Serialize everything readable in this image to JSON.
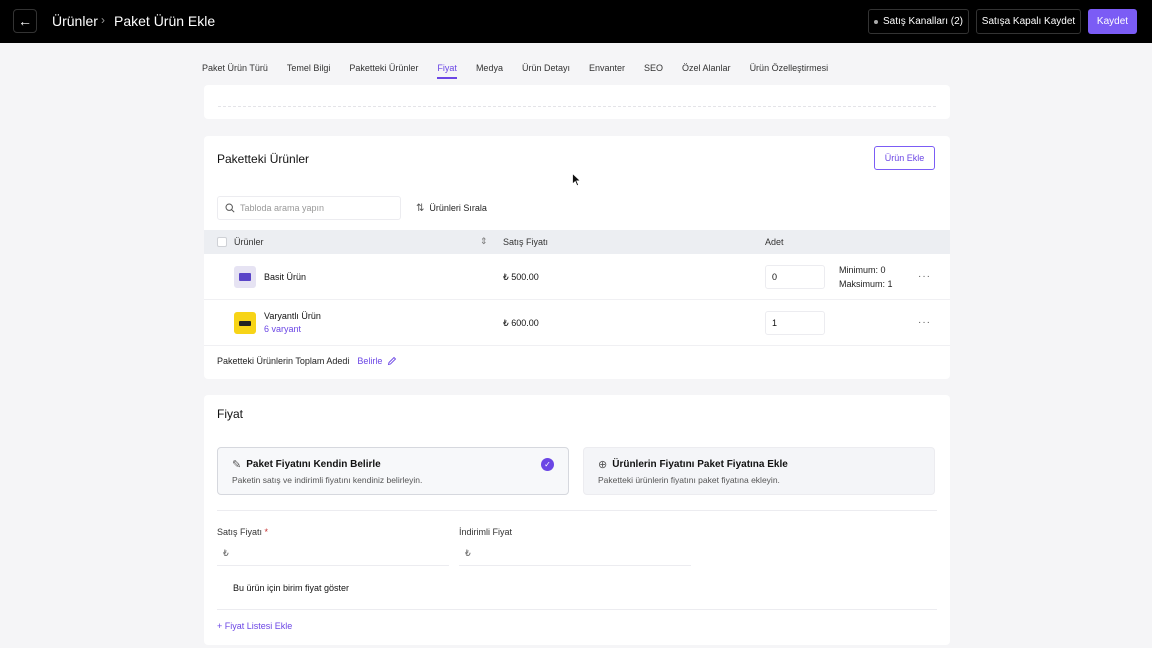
{
  "header": {
    "back_icon": "arrow-left-icon",
    "breadcrumb_root": "Ürünler",
    "breadcrumb_separator": "›",
    "page_title": "Paket Ürün Ekle",
    "channels_button": "Satış Kanalları (2)",
    "save_closed_button": "Satışa Kapalı Kaydet",
    "save_button": "Kaydet",
    "accent_color": "#7b5cf5"
  },
  "tabs": [
    {
      "label": "Paket Ürün Türü",
      "active": false
    },
    {
      "label": "Temel Bilgi",
      "active": false
    },
    {
      "label": "Paketteki Ürünler",
      "active": false
    },
    {
      "label": "Fiyat",
      "active": true
    },
    {
      "label": "Medya",
      "active": false
    },
    {
      "label": "Ürün Detayı",
      "active": false
    },
    {
      "label": "Envanter",
      "active": false
    },
    {
      "label": "SEO",
      "active": false
    },
    {
      "label": "Özel Alanlar",
      "active": false
    },
    {
      "label": "Ürün Özelleştirmesi",
      "active": false
    }
  ],
  "bundle_products": {
    "title": "Paketteki Ürünler",
    "add_product_button": "Ürün Ekle",
    "search_placeholder": "Tabloda arama yapın",
    "sort_button": "Ürünleri Sırala",
    "columns": {
      "products": "Ürünler",
      "sale_price": "Satış Fiyatı",
      "quantity": "Adet"
    },
    "rows": [
      {
        "name": "Basit Ürün",
        "variants": "",
        "price": "₺ 500.00",
        "quantity": "0",
        "minimum": "Minimum: 0",
        "maximum": "Maksimum: 1",
        "more": "···"
      },
      {
        "name": "Varyantlı Ürün",
        "variants": "6 varyant",
        "price": "₺ 600.00",
        "quantity": "1",
        "minimum": "",
        "maximum": "",
        "more": "···"
      }
    ],
    "total_label": "Paketteki Ürünlerin Toplam Adedi",
    "total_link": "Belirle"
  },
  "price": {
    "title": "Fiyat",
    "option_manual": {
      "title": "Paket Fiyatını Kendin Belirle",
      "description": "Paketin satış ve indirimli fiyatını kendiniz belirleyin.",
      "selected": true
    },
    "option_add": {
      "title": "Ürünlerin Fiyatını Paket Fiyatına Ekle",
      "description": "Paketteki ürünlerin fiyatını paket fiyatına ekleyin.",
      "selected": false
    },
    "sale_price_label": "Satış Fiyatı",
    "required_mark": "*",
    "discount_price_label": "İndirimli Fiyat",
    "currency_symbol": "₺",
    "unit_price_toggle": "Bu ürün için birim fiyat göster",
    "add_price_list": "+ Fiyat Listesi Ekle"
  }
}
